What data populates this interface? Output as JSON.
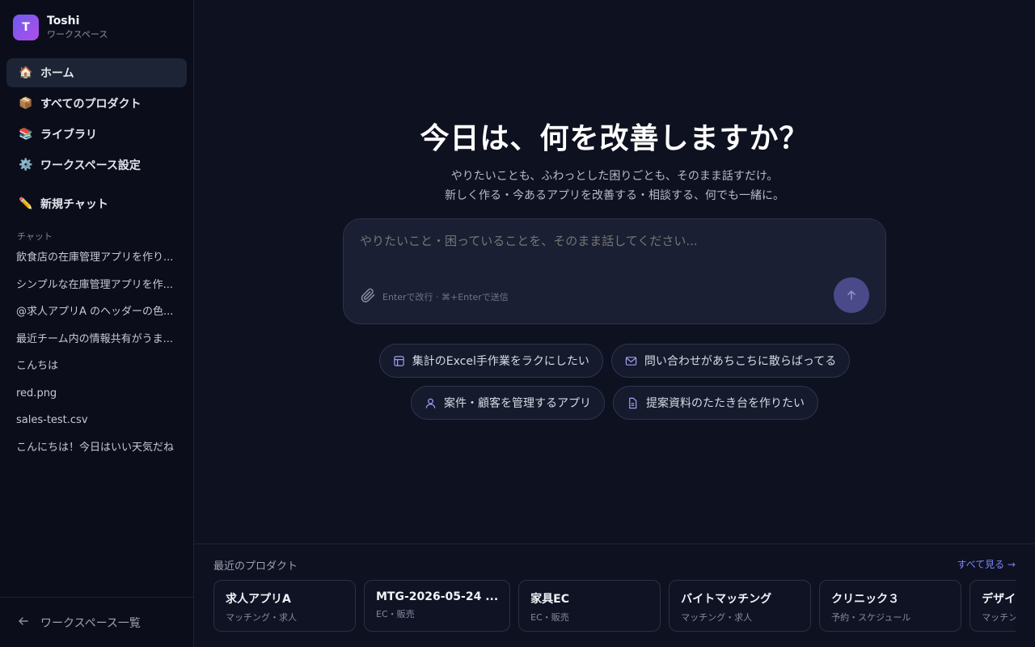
{
  "workspace": {
    "avatar_letter": "T",
    "name": "Toshi",
    "subtitle": "ワークスペース"
  },
  "nav": [
    {
      "icon": "house-emoji",
      "glyph": "🏠",
      "label": "ホーム",
      "active": true
    },
    {
      "icon": "package-emoji",
      "glyph": "📦",
      "label": "すべてのプロダクト"
    },
    {
      "icon": "books-emoji",
      "glyph": "📚",
      "label": "ライブラリ"
    },
    {
      "icon": "gear-emoji",
      "glyph": "⚙️",
      "label": "ワークスペース設定"
    }
  ],
  "new_chat": {
    "glyph": "✏️",
    "label": "新規チャット"
  },
  "chats": {
    "section_label": "チャット",
    "items": [
      "飲食店の在庫管理アプリを作り...",
      "シンプルな在庫管理アプリを作...",
      "@求人アプリA のヘッダーの色...",
      "最近チーム内の情報共有がうま...",
      "こんちは",
      "red.png",
      "sales-test.csv",
      "こんにちは！今日はいい天気だね"
    ]
  },
  "footer": {
    "label": "ワークスペース一覧"
  },
  "hero": {
    "title": "今日は、何を改善しますか？",
    "sub_line1": "やりたいことも、ふわっとした困りごとも、そのまま話すだけ。",
    "sub_line2": "新しく作る・今あるアプリを改善する・相談する、何でも一緒に。"
  },
  "composer": {
    "placeholder": "やりたいこと・困っていることを、そのまま話してください...",
    "hint": "Enterで改行 · ⌘+Enterで送信"
  },
  "suggestions": [
    {
      "icon": "table-icon",
      "label": "集計のExcel手作業をラクにしたい"
    },
    {
      "icon": "mail-icon",
      "label": "問い合わせがあちこちに散らばってる"
    },
    {
      "icon": "user-icon",
      "label": "案件・顧客を管理するアプリ"
    },
    {
      "icon": "document-icon",
      "label": "提案資料のたたき台を作りたい"
    }
  ],
  "recent": {
    "label": "最近のプロダクト",
    "see_all": "すべて見る →",
    "cards": [
      {
        "title": "求人アプリA",
        "sub": "マッチング・求人"
      },
      {
        "title": "MTG-2026-05-24 ...",
        "sub": "EC・販売"
      },
      {
        "title": "家具EC",
        "sub": "EC・販売"
      },
      {
        "title": "バイトマッチング",
        "sub": "マッチング・求人"
      },
      {
        "title": "クリニック３",
        "sub": "予約・スケジュール"
      },
      {
        "title": "デザイン",
        "sub": "マッチング"
      }
    ]
  },
  "colors": {
    "accent": "#7d86f5",
    "background": "#0e1120",
    "sidebar": "#0b0e1a"
  }
}
